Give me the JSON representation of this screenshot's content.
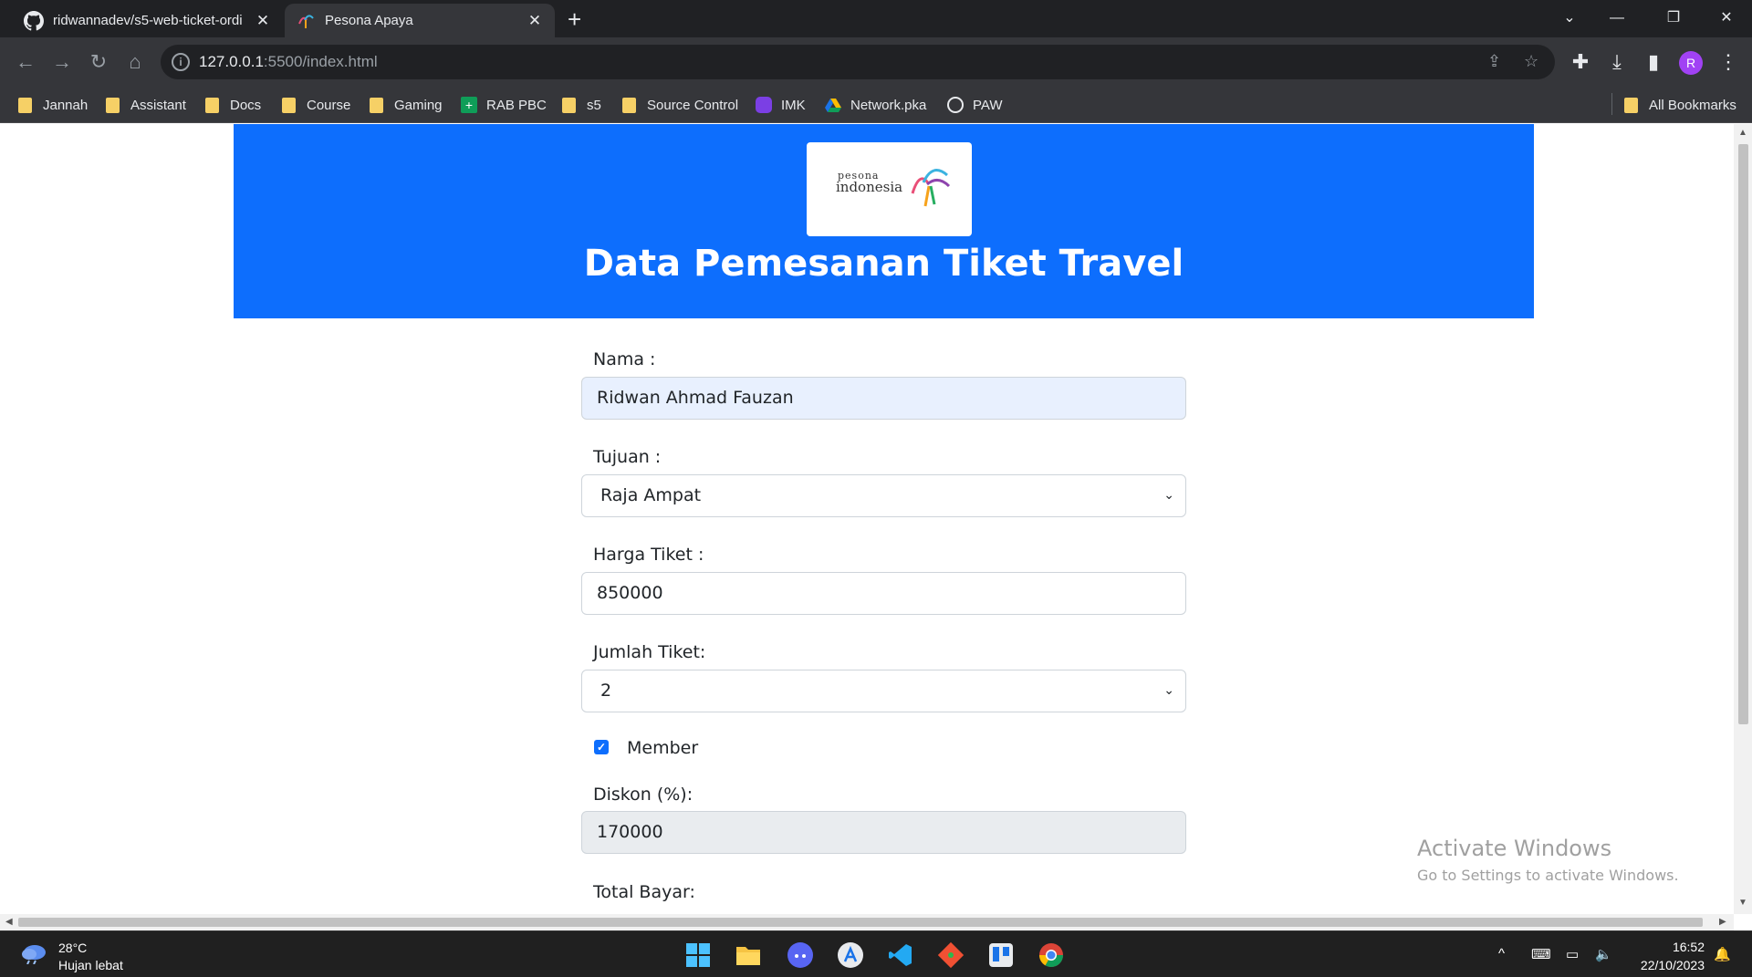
{
  "browser": {
    "tabs": [
      {
        "title": "ridwannadev/s5-web-ticket-ordi",
        "icon": "github-icon"
      },
      {
        "title": "Pesona Apaya",
        "icon": "pesona-icon",
        "active": true
      }
    ],
    "url_host": "127.0.0.1",
    "url_path": ":5500/index.html",
    "profile_initial": "R",
    "bookmarks": [
      {
        "label": "Jannah",
        "icon": "folder-icon"
      },
      {
        "label": "Assistant",
        "icon": "folder-icon"
      },
      {
        "label": "Docs",
        "icon": "folder-icon"
      },
      {
        "label": "Course",
        "icon": "folder-icon"
      },
      {
        "label": "Gaming",
        "icon": "folder-icon"
      },
      {
        "label": "RAB PBC",
        "icon": "sheets-icon"
      },
      {
        "label": "s5",
        "icon": "folder-icon"
      },
      {
        "label": "Source Control",
        "icon": "folder-icon"
      },
      {
        "label": "IMK",
        "icon": "app-icon"
      },
      {
        "label": "Network.pka",
        "icon": "drive-icon"
      },
      {
        "label": "PAW",
        "icon": "globe-icon"
      }
    ],
    "all_bookmarks": "All Bookmarks"
  },
  "page": {
    "logo_small": "pesona",
    "logo_main": "indonesia",
    "title": "Data Pemesanan Tiket Travel",
    "form": {
      "nama_label": "Nama :",
      "nama_value": "Ridwan Ahmad Fauzan",
      "tujuan_label": "Tujuan :",
      "tujuan_value": "Raja Ampat",
      "harga_label": "Harga Tiket :",
      "harga_value": "850000",
      "jumlah_label": "Jumlah Tiket:",
      "jumlah_value": "2",
      "member_label": "Member",
      "member_checked": true,
      "diskon_label": "Diskon (%):",
      "diskon_value": "170000",
      "total_label": "Total Bayar:"
    }
  },
  "watermark": {
    "line1": "Activate Windows",
    "line2": "Go to Settings to activate Windows."
  },
  "taskbar": {
    "temperature": "28°C",
    "weather": "Hujan lebat",
    "time": "16:52",
    "date": "22/10/2023"
  }
}
